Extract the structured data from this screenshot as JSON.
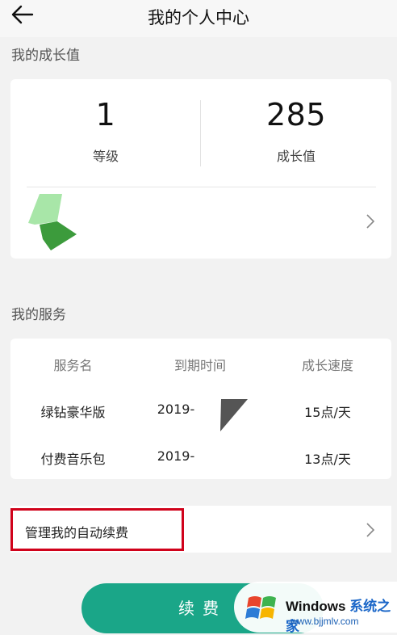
{
  "header": {
    "title": "我的个人中心",
    "back_icon": "arrow-left-icon"
  },
  "growth": {
    "section_title": "我的成长值",
    "level_value": "1",
    "level_label": "等级",
    "growth_value": "285",
    "growth_label": "成长值"
  },
  "services": {
    "section_title": "我的服务",
    "columns": [
      "服务名",
      "到期时间",
      "成长速度"
    ],
    "rows": [
      {
        "name": "绿钻豪华版",
        "expiry": "2019-",
        "speed": "15点/天"
      },
      {
        "name": "付费音乐包",
        "expiry": "2019-",
        "speed": "13点/天"
      }
    ]
  },
  "manage": {
    "label": "管理我的自动续费"
  },
  "renew": {
    "label": "续费"
  },
  "watermark": {
    "title": "Windows",
    "title_cn": "系统之家",
    "url": "www.bjjmlv.com"
  },
  "colors": {
    "accent": "#1aa688",
    "highlight_box": "#d0021b",
    "brand_blue": "#1a66c8"
  }
}
